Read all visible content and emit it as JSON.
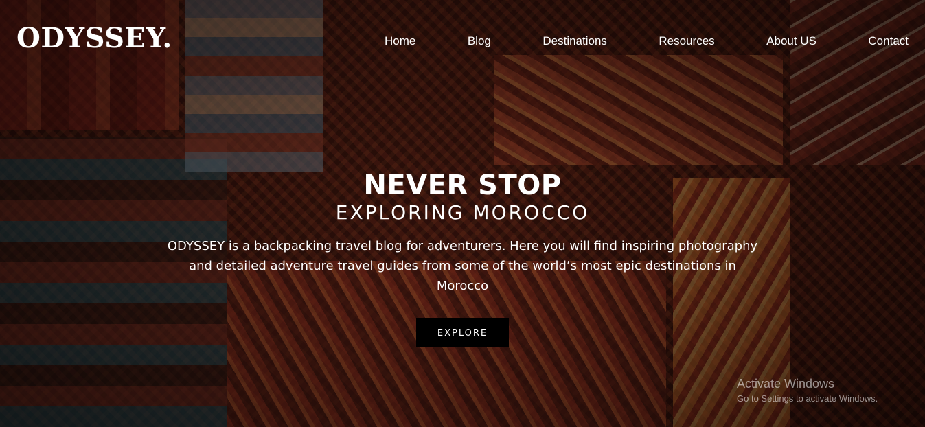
{
  "brand": {
    "logo_text": "ODYSSEY."
  },
  "nav": {
    "items": [
      {
        "label": "Home"
      },
      {
        "label": "Blog"
      },
      {
        "label": "Destinations"
      },
      {
        "label": "Resources"
      },
      {
        "label": "About US"
      },
      {
        "label": "Contact"
      }
    ]
  },
  "hero": {
    "headline": "NEVER STOP",
    "subheadline": "EXPLORING MOROCCO",
    "description": "ODYSSEY is a backpacking travel blog for adventurers. Here you will find inspiring photography and detailed adventure travel guides from some of the world’s most epic destinations in Morocco",
    "cta_label": "EXPLORE"
  },
  "watermark": {
    "title": "Activate Windows",
    "subtitle": "Go to Settings to activate Windows."
  }
}
